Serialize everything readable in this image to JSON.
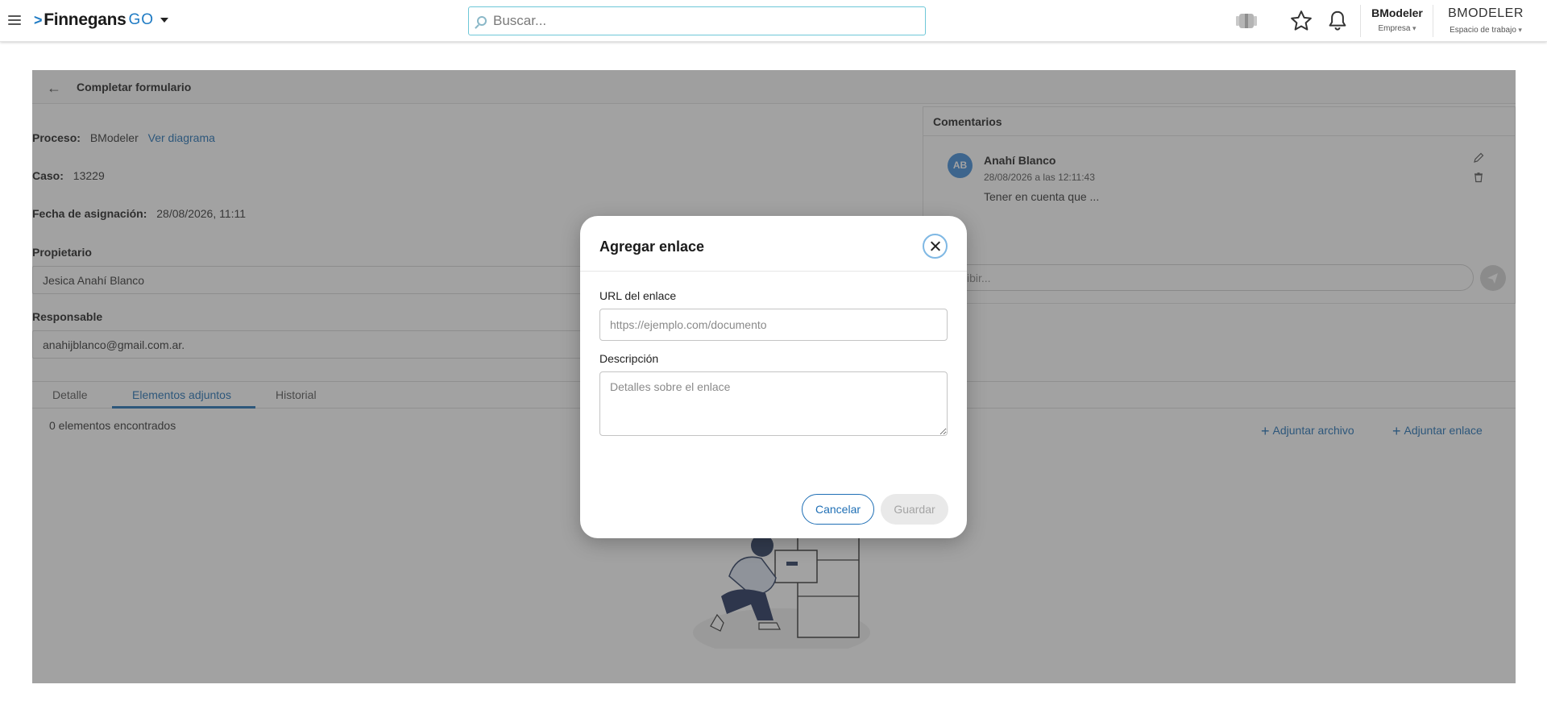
{
  "header": {
    "logo_text": "Finnegans",
    "logo_suffix": "GO",
    "search_placeholder": "Buscar...",
    "company_name": "BModeler",
    "company_label": "Empresa",
    "workspace_name": "BMODELER",
    "workspace_label": "Espacio de trabajo"
  },
  "page": {
    "title": "Completar formulario",
    "proceso_label": "Proceso:",
    "proceso_value": "BModeler",
    "ver_diagrama": "Ver diagrama",
    "caso_label": "Caso:",
    "caso_value": "13229",
    "fecha_label": "Fecha de asignación:",
    "fecha_value": "28/08/2026, 11:11",
    "propietario_label": "Propietario",
    "propietario_value": "Jesica Anahí Blanco",
    "responsable_label": "Responsable",
    "responsable_value": "anahijblanco@gmail.com.ar.",
    "tabs": [
      {
        "label": "Detalle"
      },
      {
        "label": "Elementos adjuntos"
      },
      {
        "label": "Historial"
      }
    ],
    "found_text": "0 elementos encontrados",
    "adjuntar_archivo": "Adjuntar archivo",
    "adjuntar_enlace": "Adjuntar enlace"
  },
  "comments": {
    "title": "Comentarios",
    "items": [
      {
        "initials": "AB",
        "author": "Anahí Blanco",
        "date": "28/08/2026 a las 12:11:43",
        "text": "Tener en cuenta que ..."
      }
    ],
    "compose_placeholder": "Escribir..."
  },
  "modal": {
    "title": "Agregar enlace",
    "url_label": "URL del enlace",
    "url_placeholder": "https://ejemplo.com/documento",
    "desc_label": "Descripción",
    "desc_placeholder": "Detalles sobre el enlace",
    "cancel_label": "Cancelar",
    "save_label": "Guardar"
  },
  "colors": {
    "accent": "#1f6fb5",
    "avatar": "#3e8ad6",
    "overlay": "#3c3c3c"
  }
}
